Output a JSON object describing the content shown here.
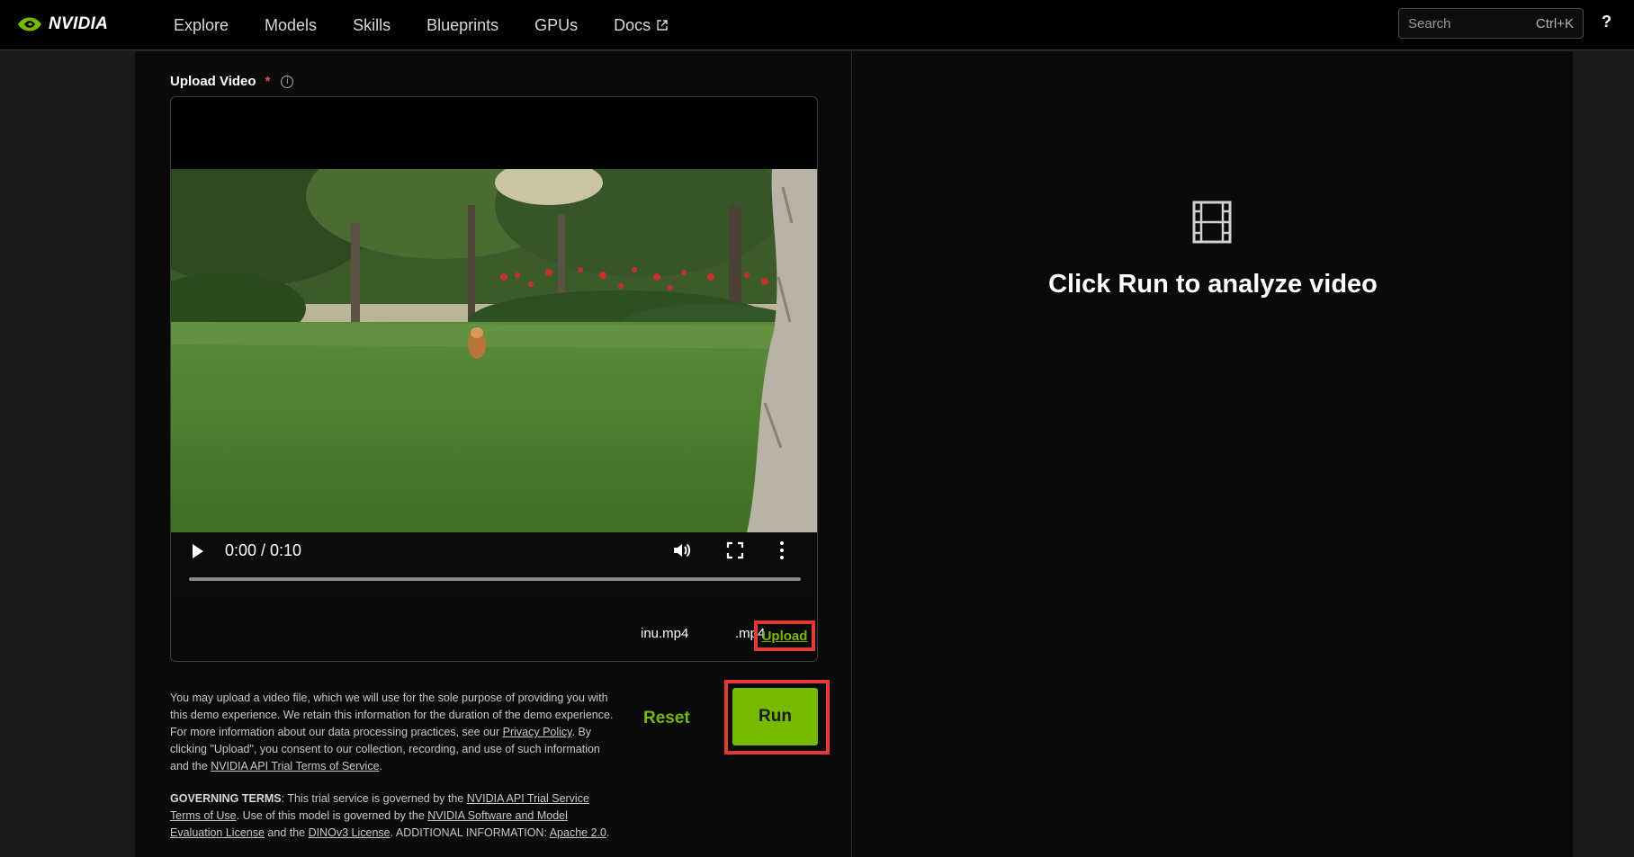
{
  "nav": {
    "brand": "NVIDIA",
    "items": [
      {
        "label": "Explore"
      },
      {
        "label": "Models"
      },
      {
        "label": "Skills"
      },
      {
        "label": "Blueprints"
      },
      {
        "label": "GPUs"
      },
      {
        "label": "Docs",
        "icon": "external-link-icon"
      }
    ],
    "search_placeholder": "Search",
    "search_shortcut": "Ctrl+K",
    "help_label": "?"
  },
  "upload": {
    "label": "Upload Video",
    "required_mark": "*",
    "info_icon": "info-icon",
    "video": {
      "time": "0:00 / 0:10",
      "progress": 0
    },
    "file_name": "inu.mp4",
    "file_ext": ".mp4",
    "upload_label": "Upload"
  },
  "actions": {
    "reset_label": "Reset",
    "run_label": "Run"
  },
  "disclaimer": {
    "text1": "You may upload a video file, which we will use for the sole purpose of providing you with this demo experience. We retain this information for the duration of the demo experience. For more information about our data processing practices, see our ",
    "privacy_link": "Privacy Policy",
    "text2": ". By clicking \"Upload\", you consent to our collection, recording, and use of such information and the ",
    "terms_link": "NVIDIA API Trial Terms of Service",
    "text3": "."
  },
  "governing": {
    "heading": "GOVERNING TERMS",
    "text1": ": This trial service is governed by the ",
    "link1": "NVIDIA API Trial Service Terms of Use",
    "text2": ". Use of this model is governed by the ",
    "link2": "NVIDIA Software and Model Evaluation License",
    "text3": " and the ",
    "link3": "DINOv3 License",
    "text4": ". ADDITIONAL INFORMATION: ",
    "link4": "Apache 2.0",
    "text5": "."
  },
  "result": {
    "icon": "film-icon",
    "message": "Click Run to analyze video"
  },
  "colors": {
    "accent": "#76b900",
    "highlight": "#e53935"
  }
}
